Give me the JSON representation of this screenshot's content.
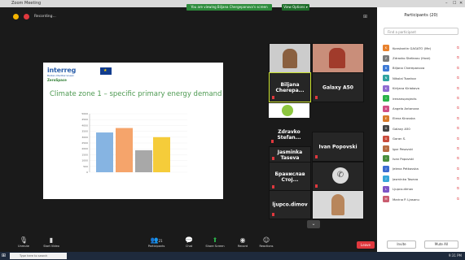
{
  "window": {
    "title": "Zoom Meeting"
  },
  "recording": {
    "label": "Recording..."
  },
  "banner": {
    "text": "You are viewing Biljana Chergepanova's screen",
    "view_options": "View Options ▾"
  },
  "slide": {
    "logo_line1": "interreg",
    "logo_line2": "Balkan-Mediterranean",
    "logo_line3": "ZeroSpace",
    "title": "Climate zone 1 – specific primary energy demand"
  },
  "chart_data": {
    "type": "bar",
    "categories": [
      "",
      "",
      "",
      ""
    ],
    "values": [
      3400,
      3780,
      1880,
      3000
    ],
    "colors": [
      "#86b4e2",
      "#f5a46b",
      "#a8a8a8",
      "#f5cc3a"
    ],
    "ylim": [
      0,
      5000
    ],
    "ticks": [
      "5000",
      "4500",
      "4000",
      "3500",
      "3000",
      "2500",
      "2000",
      "1500",
      "1000",
      "500",
      "0"
    ]
  },
  "tiles": [
    {
      "name": "Biljana  Cherepa..."
    },
    {
      "name": "Galaxy A50"
    },
    {
      "name": "Zdravko  Stefan..."
    },
    {
      "name": "Jasminka Taseva"
    },
    {
      "name": "Ivan Popovski"
    },
    {
      "name": "Бранислав  Стој..."
    },
    {
      "name": "ljupco.dimov"
    }
  ],
  "participants": {
    "header": "Participants (20)",
    "search_placeholder": "Find a participant",
    "list": [
      {
        "initials": "K",
        "name": "Konstantin GAGATO (Me)",
        "color": "#e8812d"
      },
      {
        "initials": "Z",
        "name": "Zdravko Stefanov (Host)",
        "color": "#7a7a7a"
      },
      {
        "initials": "B",
        "name": "Biljana Cherepanova",
        "color": "#3d7ad6"
      },
      {
        "initials": "N",
        "name": "Nikolai Tsankov",
        "color": "#2fa3a0"
      },
      {
        "initials": "K",
        "name": "Kirijana Kiriakova",
        "color": "#8e6bd1"
      },
      {
        "initials": "I",
        "name": "irenaeuprojects",
        "color": "#2bb34a"
      },
      {
        "initials": "A",
        "name": "Angela Antonova",
        "color": "#d04e85"
      },
      {
        "initials": "E",
        "name": "Elena Kirovska",
        "color": "#d87a2a"
      },
      {
        "initials": "G",
        "name": "Galaxy A50",
        "color": "#444"
      },
      {
        "initials": "G",
        "name": "Goran S.",
        "color": "#c94b3c"
      },
      {
        "initials": "I",
        "name": "Igor Pesovski",
        "color": "#b86b42"
      },
      {
        "initials": "I",
        "name": "Ivan Popovski",
        "color": "#4a8e3d"
      },
      {
        "initials": "J",
        "name": "Jelena Petkovska",
        "color": "#3a6bd0"
      },
      {
        "initials": "J",
        "name": "Jasminka Taseva",
        "color": "#35a6d9"
      },
      {
        "initials": "L",
        "name": "Ljupco.dimov",
        "color": "#7d54c6"
      },
      {
        "initials": "M",
        "name": "Marina P. Ljasanu",
        "color": "#c95c6f"
      }
    ],
    "invite": "Invite",
    "mute_all": "Mute All"
  },
  "toolbar": {
    "unmute": "Unmute",
    "start_video": "Start Video",
    "participants": "Participants",
    "participants_count": "21",
    "chat": "Chat",
    "share_screen": "Share Screen",
    "record": "Record",
    "reactions": "Reactions",
    "leave": "Leave"
  },
  "taskbar": {
    "search": "Type here to search",
    "clock": "9:31 PM"
  }
}
